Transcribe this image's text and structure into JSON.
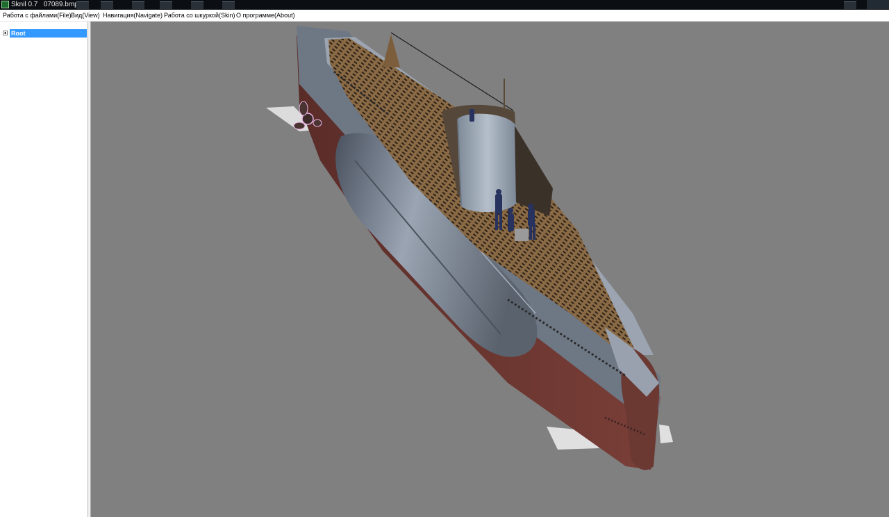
{
  "window": {
    "title": "Sknil 0.7   07089.bmp"
  },
  "menu": [
    {
      "label": "Работа с файлами(File)"
    },
    {
      "label": "Вид(View)"
    },
    {
      "label": "Навигация(Navigate)"
    },
    {
      "label": "Работа со шкуркой(Skin)"
    },
    {
      "label": "О программе(About)"
    }
  ],
  "tree": {
    "root_label": "Root"
  },
  "viewport": {
    "background": "#808080",
    "model": "submarine-3d-model"
  }
}
